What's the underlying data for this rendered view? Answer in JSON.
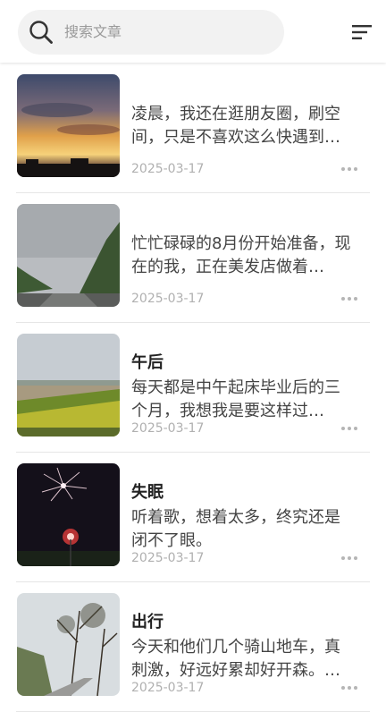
{
  "search": {
    "placeholder": "搜索文章"
  },
  "articles": [
    {
      "title": "",
      "excerpt": "凌晨，我还在逛朋友圈，刷空间，只是不喜欢这么快遇到…",
      "date": "2025-03-17",
      "thumb_icon": "sunset-photo"
    },
    {
      "title": "",
      "excerpt": "忙忙碌碌的8月份开始准备，现在的我，正在美发店做着…",
      "date": "2025-03-17",
      "thumb_icon": "mountain-road-photo"
    },
    {
      "title": "午后",
      "excerpt": "每天都是中午起床毕业后的三个月，我想我是要这样过…",
      "date": "2025-03-17",
      "thumb_icon": "field-photo"
    },
    {
      "title": "失眠",
      "excerpt": "听着歌，想着太多，终究还是闭不了眼。",
      "date": "2025-03-17",
      "thumb_icon": "fireworks-photo"
    },
    {
      "title": "出行",
      "excerpt": "今天和他们几个骑山地车，真刺激，好远好累却好开森。…",
      "date": "2025-03-17",
      "thumb_icon": "trees-road-photo"
    }
  ]
}
